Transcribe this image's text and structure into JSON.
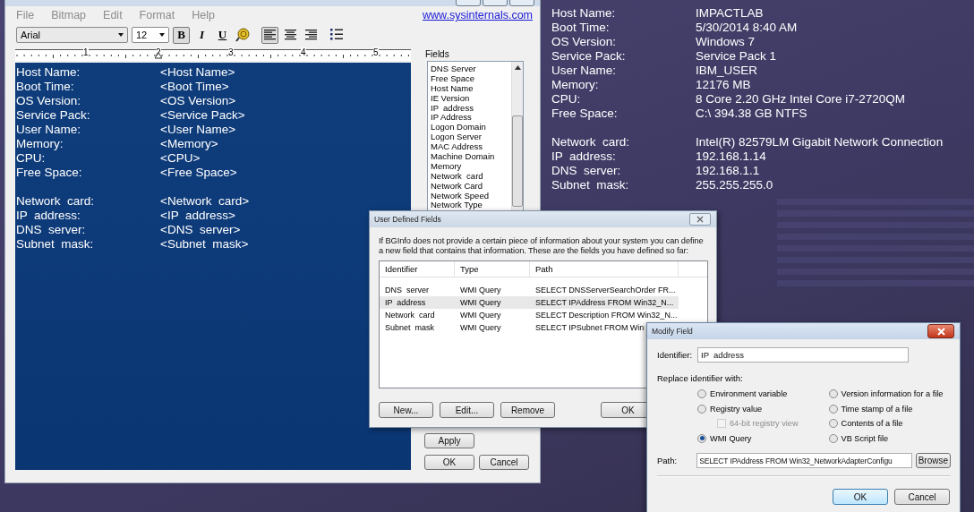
{
  "desktop_info": {
    "groups": [
      [
        {
          "label": "Host Name:",
          "value": "IMPACTLAB"
        },
        {
          "label": "Boot Time:",
          "value": "5/30/2014 8:40 AM"
        },
        {
          "label": "OS Version:",
          "value": "Windows 7"
        },
        {
          "label": "Service Pack:",
          "value": "Service Pack 1"
        },
        {
          "label": "User Name:",
          "value": "IBM_USER"
        },
        {
          "label": "Memory:",
          "value": "12176 MB"
        },
        {
          "label": "CPU:",
          "value": "8 Core 2.20 GHz Intel Core i7-2720QM"
        },
        {
          "label": "Free Space:",
          "value": "C:\\ 394.38 GB NTFS"
        }
      ],
      [
        {
          "label": "Network  card:",
          "value": "Intel(R) 82579LM Gigabit Network Connection"
        },
        {
          "label": "IP  address:",
          "value": "192.168.1.14"
        },
        {
          "label": "DNS  server:",
          "value": "192.168.1.1"
        },
        {
          "label": "Subnet  mask:",
          "value": "255.255.255.0"
        }
      ]
    ]
  },
  "main_window": {
    "menu": [
      "File",
      "Bitmap",
      "Edit",
      "Format",
      "Help"
    ],
    "link": "www.sysinternals.com",
    "font": "Arial",
    "size": "12",
    "format_buttons": [
      {
        "kind": "bold",
        "label": "B",
        "selected": true
      },
      {
        "kind": "italic",
        "label": "I",
        "selected": false
      },
      {
        "kind": "underline",
        "label": "U",
        "selected": false
      }
    ],
    "align_buttons": [
      {
        "kind": "left",
        "selected": true
      },
      {
        "kind": "center",
        "selected": false
      },
      {
        "kind": "right",
        "selected": false
      }
    ],
    "ruler_labels": [
      "1",
      "2",
      "3",
      "4",
      "5"
    ],
    "editor": {
      "groups": [
        [
          {
            "label": "Host Name:",
            "value": "<Host Name>"
          },
          {
            "label": "Boot Time:",
            "value": "<Boot Time>"
          },
          {
            "label": "OS Version:",
            "value": "<OS Version>"
          },
          {
            "label": "Service Pack:",
            "value": "<Service Pack>"
          },
          {
            "label": "User Name:",
            "value": "<User Name>"
          },
          {
            "label": "Memory:",
            "value": "<Memory>"
          },
          {
            "label": "CPU:",
            "value": "<CPU>"
          },
          {
            "label": "Free Space:",
            "value": "<Free Space>"
          }
        ],
        [
          {
            "label": "Network  card:",
            "value": "<Network  card>"
          },
          {
            "label": "IP  address:",
            "value": "<IP  address>"
          },
          {
            "label": "DNS  server:",
            "value": "<DNS  server>"
          },
          {
            "label": "Subnet  mask:",
            "value": "<Subnet  mask>"
          }
        ]
      ]
    },
    "fields": {
      "title": "Fields",
      "items": [
        "DNS Server",
        "Free Space",
        "Host Name",
        "IE Version",
        "IP  address",
        "IP Address",
        "Logon Domain",
        "Logon Server",
        "MAC Address",
        "Machine Domain",
        "Memory",
        "Network  card",
        "Network Card",
        "Network Speed",
        "Network Type"
      ]
    },
    "buttons": {
      "apply": "Apply",
      "ok": "OK",
      "cancel": "Cancel"
    }
  },
  "user_defined_fields": {
    "title": "User Defined Fields",
    "description": "If BGInfo does not provide a certain piece of information about your system you can define a new field that contains that information. These are the fields you have defined so far:",
    "columns": [
      "Identifier",
      "Type",
      "Path"
    ],
    "rows": [
      {
        "identifier": "DNS  server",
        "type": "WMI Query",
        "path": "SELECT DNSServerSearchOrder FR...",
        "selected": false
      },
      {
        "identifier": "IP  address",
        "type": "WMI Query",
        "path": "SELECT IPAddress FROM Win32_N...",
        "selected": true
      },
      {
        "identifier": "Network  card",
        "type": "WMI Query",
        "path": "SELECT Description FROM Win32_N...",
        "selected": false
      },
      {
        "identifier": "Subnet  mask",
        "type": "WMI Query",
        "path": "SELECT IPSubnet FROM Win",
        "selected": false
      }
    ],
    "buttons": [
      "New...",
      "Edit...",
      "Remove"
    ],
    "ok": "OK"
  },
  "modify_field": {
    "title": "Modify Field",
    "identifier_label": "Identifier:",
    "identifier": "IP  address",
    "replace_label": "Replace identifier with:",
    "options": [
      [
        {
          "kind": "radio",
          "label": "Environment variable",
          "selected": false
        },
        {
          "kind": "radio",
          "label": "Registry value",
          "selected": false
        },
        {
          "kind": "checkbox",
          "label": "64-bit registry view",
          "checked": false,
          "disabled": true
        },
        {
          "kind": "radio",
          "label": "WMI Query",
          "selected": true
        }
      ],
      [
        {
          "kind": "radio",
          "label": "Version information for a file",
          "selected": false
        },
        {
          "kind": "radio",
          "label": "Time stamp of a file",
          "selected": false
        },
        {
          "kind": "radio",
          "label": "Contents of a file",
          "selected": false
        },
        {
          "kind": "radio",
          "label": "VB Script file",
          "selected": false
        }
      ]
    ],
    "path_label": "Path:",
    "path": "SELECT IPAddress FROM Win32_NetworkAdapterConfigu",
    "browse": "Browse",
    "ok": "OK",
    "cancel": "Cancel"
  }
}
